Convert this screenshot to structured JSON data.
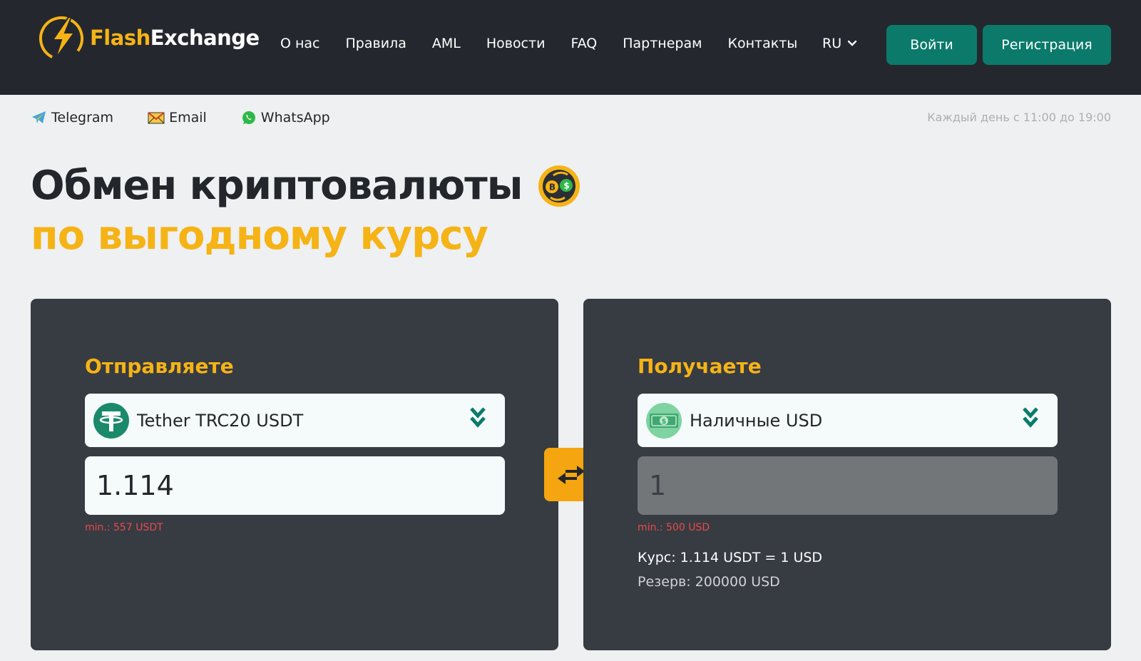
{
  "header": {
    "logo": {
      "flash": "Flash",
      "exchange": "Exchange"
    },
    "nav": [
      {
        "label": "О нас"
      },
      {
        "label": "Правила"
      },
      {
        "label": "AML"
      },
      {
        "label": "Новости"
      },
      {
        "label": "FAQ"
      },
      {
        "label": "Партнерам"
      },
      {
        "label": "Контакты"
      }
    ],
    "language": "RU",
    "login_label": "Войти",
    "register_label": "Регистрация"
  },
  "contacts": {
    "telegram": "Telegram",
    "email": "Email",
    "whatsapp": "WhatsApp",
    "hours": "Каждый день с 11:00 до 19:00"
  },
  "hero": {
    "line1": "Обмен криптовалюты",
    "line2": "по выгодному курсу"
  },
  "send": {
    "title": "Отправляете",
    "currency": "Tether TRC20 USDT",
    "amount": "1.114",
    "min": "min.: 557 USDT"
  },
  "receive": {
    "title": "Получаете",
    "currency": "Наличные USD",
    "amount": "1",
    "min": "min.: 500 USD",
    "rate": "Курс: 1.114 USDT = 1 USD",
    "reserve": "Резерв: 200000 USD"
  },
  "colors": {
    "accent": "#f5b316",
    "primary": "#0b7a6a",
    "panel": "#373b42",
    "header": "#24282e",
    "error": "#ea4b4b"
  },
  "icons": {
    "logo": "lightning-bolt-icon",
    "telegram": "telegram-icon",
    "email": "envelope-icon",
    "whatsapp": "whatsapp-icon",
    "hero": "crypto-exchange-coin-icon",
    "send_currency": "tether-icon",
    "receive_currency": "cash-usd-icon",
    "chevron": "double-chevron-down-icon",
    "swap": "swap-arrows-icon"
  }
}
